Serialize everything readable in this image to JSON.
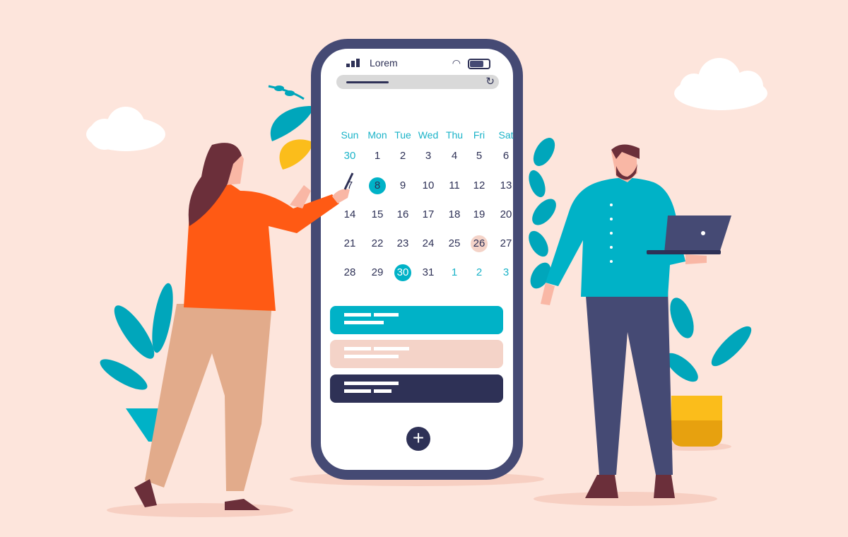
{
  "status_bar": {
    "carrier": "Lorem",
    "wifi_icon": "wifi-icon",
    "battery_icon": "battery-icon",
    "signal_icon": "signal-icon"
  },
  "url_bar": {
    "reload_icon": "reload-icon"
  },
  "calendar": {
    "weekdays": [
      "Sun",
      "Mon",
      "Tue",
      "Wed",
      "Thu",
      "Fri",
      "Sat"
    ],
    "weeks": [
      [
        "30",
        "1",
        "2",
        "3",
        "4",
        "5",
        "6"
      ],
      [
        "7",
        "8",
        "9",
        "10",
        "11",
        "12",
        "13"
      ],
      [
        "14",
        "15",
        "16",
        "17",
        "18",
        "19",
        "20"
      ],
      [
        "21",
        "22",
        "23",
        "24",
        "25",
        "26",
        "27"
      ],
      [
        "28",
        "29",
        "30",
        "31",
        "1",
        "2",
        "3"
      ]
    ],
    "muted_cells": [
      [
        0,
        0
      ],
      [
        4,
        4
      ],
      [
        4,
        5
      ],
      [
        4,
        6
      ]
    ],
    "selected_cells": [
      [
        1,
        1
      ],
      [
        4,
        2
      ]
    ],
    "marked_cells": [
      [
        3,
        5
      ]
    ]
  },
  "event_cards": [
    {
      "color": "#00b2c7"
    },
    {
      "color": "#f4d3c8"
    },
    {
      "color": "#2e3156"
    }
  ],
  "add_button": {
    "icon": "plus-icon"
  },
  "colors": {
    "background": "#fde5dc",
    "accent": "#00b2c7",
    "phone_frame": "#454a74",
    "navy": "#2e3156",
    "pink": "#f4d3c8",
    "orange": "#ff5a14"
  }
}
